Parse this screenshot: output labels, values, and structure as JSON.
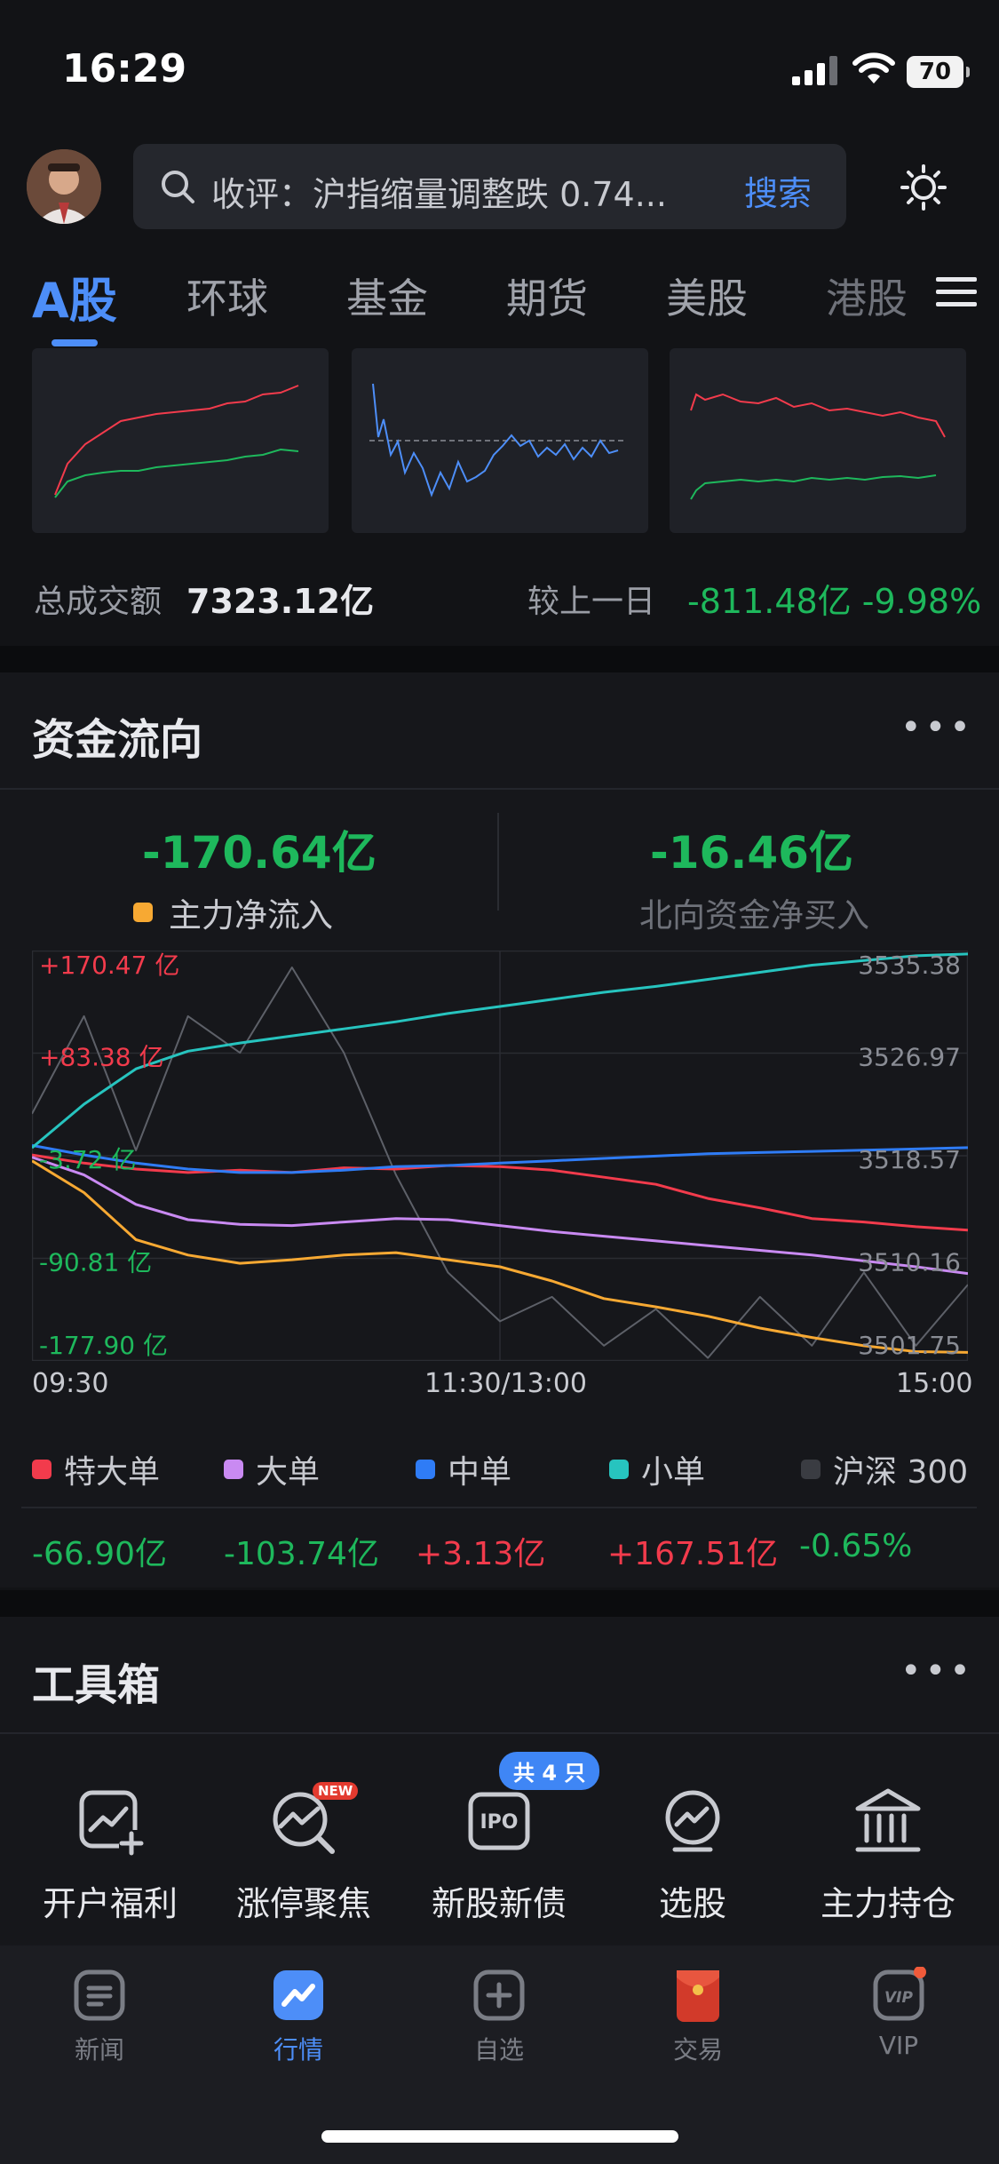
{
  "status": {
    "time": "16:29",
    "battery": "70"
  },
  "search": {
    "text": "收评：沪指缩量调整跌 0.74...",
    "button": "搜索"
  },
  "tabs": [
    "A股",
    "环球",
    "基金",
    "期货",
    "美股",
    "港股"
  ],
  "market": {
    "turnover_label": "总成交额",
    "turnover_value": "7323.12亿",
    "prev_label": "较上一日",
    "prev_change": "-811.48亿 -9.98%"
  },
  "fund_flow": {
    "title": "资金流向",
    "main_value": "-170.64亿",
    "main_label": "主力净流入",
    "north_value": "-16.46亿",
    "north_label": "北向资金净买入",
    "chart_data": {
      "type": "line",
      "x_ticks": [
        "09:30",
        "11:30/13:00",
        "15:00"
      ],
      "y_left_ticks": [
        "+170.47 亿",
        "+83.38 亿",
        "-3.72 亿",
        "-90.81 亿",
        "-177.90 亿"
      ],
      "y_right_ticks": [
        "3535.38",
        "3526.97",
        "3518.57",
        "3510.16",
        "3501.75"
      ],
      "grid": true,
      "series": [
        {
          "name": "特大单",
          "color": "#f23b4c",
          "values": [
            -3,
            -10,
            -15,
            -18,
            -16,
            -18,
            -14,
            -15,
            -12,
            -13,
            -16,
            -22,
            -28,
            -40,
            -48,
            -57,
            -60,
            -64,
            -66.9
          ]
        },
        {
          "name": "大单",
          "color": "#c98af2",
          "values": [
            -5,
            -20,
            -45,
            -58,
            -62,
            -63,
            -60,
            -57,
            -58,
            -63,
            -68,
            -72,
            -76,
            -80,
            -84,
            -88,
            -93,
            -98,
            -103.74
          ]
        },
        {
          "name": "中单",
          "color": "#2f7cf6",
          "values": [
            5,
            -3,
            -10,
            -15,
            -18,
            -18,
            -16,
            -13,
            -12,
            -10,
            -8,
            -6,
            -4,
            -2,
            -1,
            0,
            1,
            2,
            3.13
          ]
        },
        {
          "name": "小单",
          "color": "#27c4bf",
          "values": [
            3,
            40,
            70,
            85,
            92,
            98,
            104,
            110,
            117,
            123,
            129,
            135,
            140,
            146,
            152,
            158,
            162,
            166,
            167.51
          ]
        },
        {
          "name": "沪深 300",
          "color": "#5d6068",
          "values": [
            3522,
            3530,
            3519,
            3530,
            3527,
            3534,
            3527,
            3517,
            3509,
            3505,
            3507,
            3503,
            3506,
            3502,
            3507,
            3503,
            3509,
            3503,
            3508
          ]
        },
        {
          "name": "主力净流入",
          "color": "#f7a933",
          "values": [
            -8,
            -35,
            -75,
            -88,
            -95,
            -92,
            -88,
            -86,
            -92,
            -98,
            -110,
            -125,
            -132,
            -140,
            -150,
            -158,
            -165,
            -170,
            -170.64
          ]
        }
      ]
    },
    "legend": [
      {
        "name": "特大单",
        "color": "#f23b4c",
        "value": "-66.90亿",
        "value_color": "#1eb85c"
      },
      {
        "name": "大单",
        "color": "#c98af2",
        "value": "-103.74亿",
        "value_color": "#1eb85c"
      },
      {
        "name": "中单",
        "color": "#2f7cf6",
        "value": "+3.13亿",
        "value_color": "#f23b4c"
      },
      {
        "name": "小单",
        "color": "#27c4bf",
        "value": "+167.51亿",
        "value_color": "#f23b4c"
      },
      {
        "name": "沪深 300",
        "color": "#3a3c42",
        "value": "-0.65%",
        "value_color": "#1eb85c"
      }
    ]
  },
  "toolbox": {
    "title": "工具箱",
    "badge_new": "NEW",
    "badge_ipo": "共 4 只",
    "tools": [
      "开户福利",
      "涨停聚焦",
      "新股新债",
      "选股",
      "主力持仓"
    ]
  },
  "nav": [
    {
      "label": "新闻",
      "icon": "news-icon"
    },
    {
      "label": "行情",
      "icon": "market-icon"
    },
    {
      "label": "自选",
      "icon": "watchlist-icon"
    },
    {
      "label": "交易",
      "icon": "trade-icon"
    },
    {
      "label": "VIP",
      "icon": "vip-icon"
    }
  ]
}
